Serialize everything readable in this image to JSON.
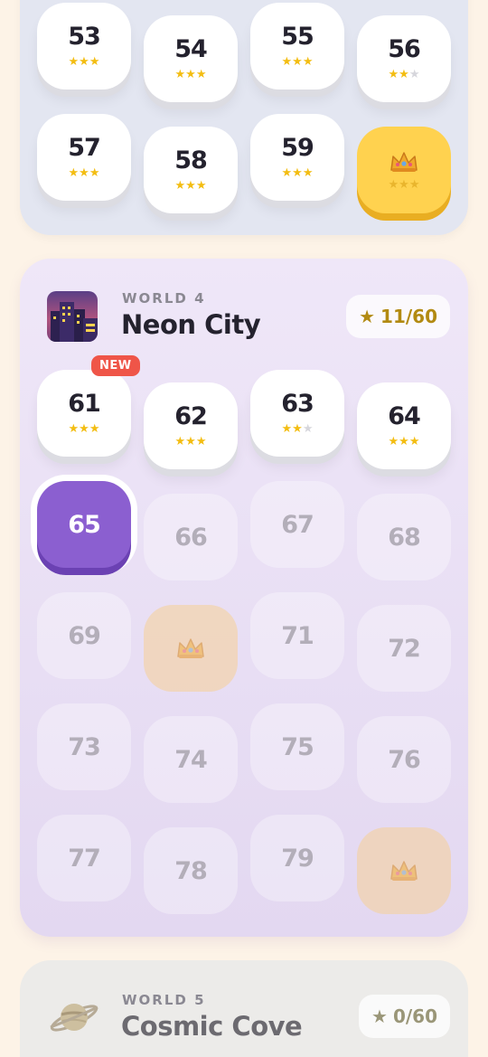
{
  "world3": {
    "levels": [
      {
        "num": "53",
        "state": "done",
        "stars": 3
      },
      {
        "num": "54",
        "state": "done",
        "stars": 3
      },
      {
        "num": "55",
        "state": "done",
        "stars": 3
      },
      {
        "num": "56",
        "state": "done",
        "stars": 2
      },
      {
        "num": "57",
        "state": "done",
        "stars": 3
      },
      {
        "num": "58",
        "state": "done",
        "stars": 3
      },
      {
        "num": "59",
        "state": "done",
        "stars": 3
      },
      {
        "num": "",
        "state": "crown",
        "stars": 0
      }
    ]
  },
  "world4": {
    "kicker": "WORLD 4",
    "title": "Neon City",
    "stars_label": "11/60",
    "new_badge": "NEW",
    "levels": [
      {
        "num": "61",
        "state": "done",
        "stars": 3
      },
      {
        "num": "62",
        "state": "done",
        "stars": 3
      },
      {
        "num": "63",
        "state": "done",
        "stars": 2
      },
      {
        "num": "64",
        "state": "done",
        "stars": 3
      },
      {
        "num": "65",
        "state": "current"
      },
      {
        "num": "66",
        "state": "locked"
      },
      {
        "num": "67",
        "state": "locked"
      },
      {
        "num": "68",
        "state": "locked"
      },
      {
        "num": "69",
        "state": "locked"
      },
      {
        "num": "",
        "state": "crown-locked"
      },
      {
        "num": "71",
        "state": "locked"
      },
      {
        "num": "72",
        "state": "locked"
      },
      {
        "num": "73",
        "state": "locked"
      },
      {
        "num": "74",
        "state": "locked"
      },
      {
        "num": "75",
        "state": "locked"
      },
      {
        "num": "76",
        "state": "locked"
      },
      {
        "num": "77",
        "state": "locked"
      },
      {
        "num": "78",
        "state": "locked"
      },
      {
        "num": "79",
        "state": "locked"
      },
      {
        "num": "",
        "state": "crown-locked"
      }
    ]
  },
  "world5": {
    "kicker": "WORLD 5",
    "title": "Cosmic Cove",
    "stars_label": "0/60"
  },
  "colors": {
    "accent_purple": "#8b5fd0",
    "star_gold": "#f3bd12",
    "crown_yellow": "#ffd24f",
    "new_red": "#ef5548"
  },
  "icons": {
    "star": "star-icon",
    "crown": "crown-icon",
    "world4": "neon-city-icon",
    "world5": "planet-icon"
  }
}
